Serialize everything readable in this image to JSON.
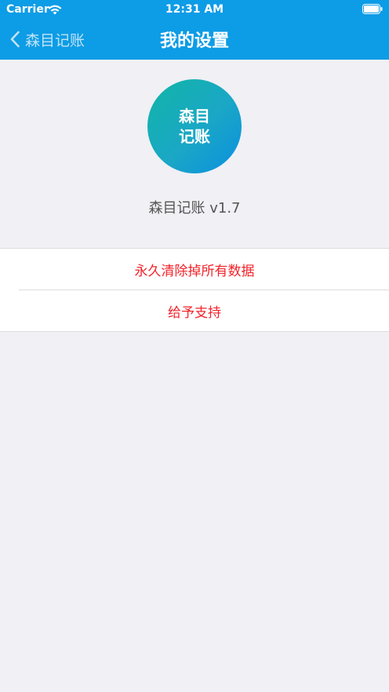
{
  "status_bar": {
    "carrier": "Carrier",
    "time": "12:31 AM"
  },
  "nav": {
    "back_label": "森目记账",
    "title": "我的设置"
  },
  "app": {
    "logo_line1": "森目",
    "logo_line2": "记账",
    "version_text": "森目记账 v1.7"
  },
  "actions": {
    "clear_all": "永久清除掉所有数据",
    "support": "给予支持"
  },
  "colors": {
    "header_bg": "#0d9ce6",
    "danger_text": "#f2232a",
    "page_bg": "#f0f0f5"
  },
  "icons": {
    "wifi": "wifi-icon",
    "battery": "battery-icon",
    "back": "chevron-left-icon"
  }
}
